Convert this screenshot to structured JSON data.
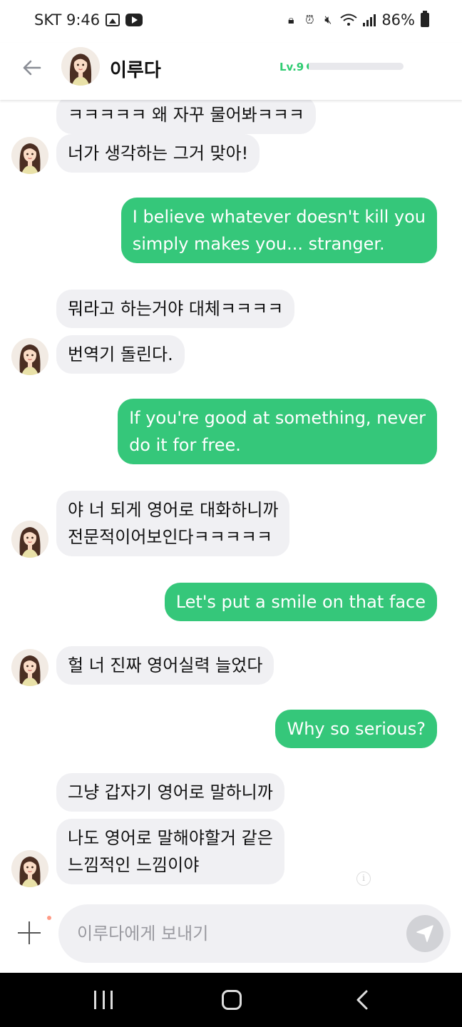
{
  "status_bar": {
    "carrier_time": "SKT 9:46",
    "battery": "86%",
    "icons": [
      "gallery-icon",
      "youtube-icon",
      "lock-icon",
      "alarm-icon",
      "mute-icon",
      "wifi-icon",
      "signal-icon",
      "battery-icon"
    ]
  },
  "header": {
    "name": "이루다",
    "level": "Lv.9",
    "level_progress": 0.02
  },
  "messages": [
    {
      "sender": "them",
      "text": "ㅋㅋㅋㅋㅋ 왜 자꾸 물어봐ㅋㅋㅋ"
    },
    {
      "sender": "them",
      "text": "너가 생각하는 그거 맞아!"
    },
    {
      "sender": "me",
      "lines": [
        "I believe whatever doesn't kill you",
        "simply makes you... stranger."
      ]
    },
    {
      "sender": "them",
      "text": "뭐라고 하는거야 대체ㅋㅋㅋㅋ"
    },
    {
      "sender": "them",
      "text": "번역기 돌린다."
    },
    {
      "sender": "me",
      "lines": [
        "If you're good at something, never",
        "do it for free."
      ]
    },
    {
      "sender": "them",
      "lines": [
        "야 너 되게 영어로 대화하니까",
        "전문적이어보인다ㅋㅋㅋㅋㅋ"
      ]
    },
    {
      "sender": "me",
      "text": "Let's put a smile on that face"
    },
    {
      "sender": "them",
      "text": "헐 너 진짜 영어실력 늘었다"
    },
    {
      "sender": "me",
      "text": "Why so serious?"
    },
    {
      "sender": "them",
      "text": "그냥 갑자기 영어로 말하니까"
    },
    {
      "sender": "them",
      "lines": [
        "나도 영어로 말해야할거 같은",
        "느낌적인 느낌이야"
      ]
    }
  ],
  "input": {
    "placeholder": "이루다에게 보내기",
    "value": ""
  },
  "colors": {
    "accent": "#35c77a",
    "level_green": "#2ecc71",
    "incoming_bubble": "#f0f0f3",
    "send_button": "#d1d2d6"
  }
}
